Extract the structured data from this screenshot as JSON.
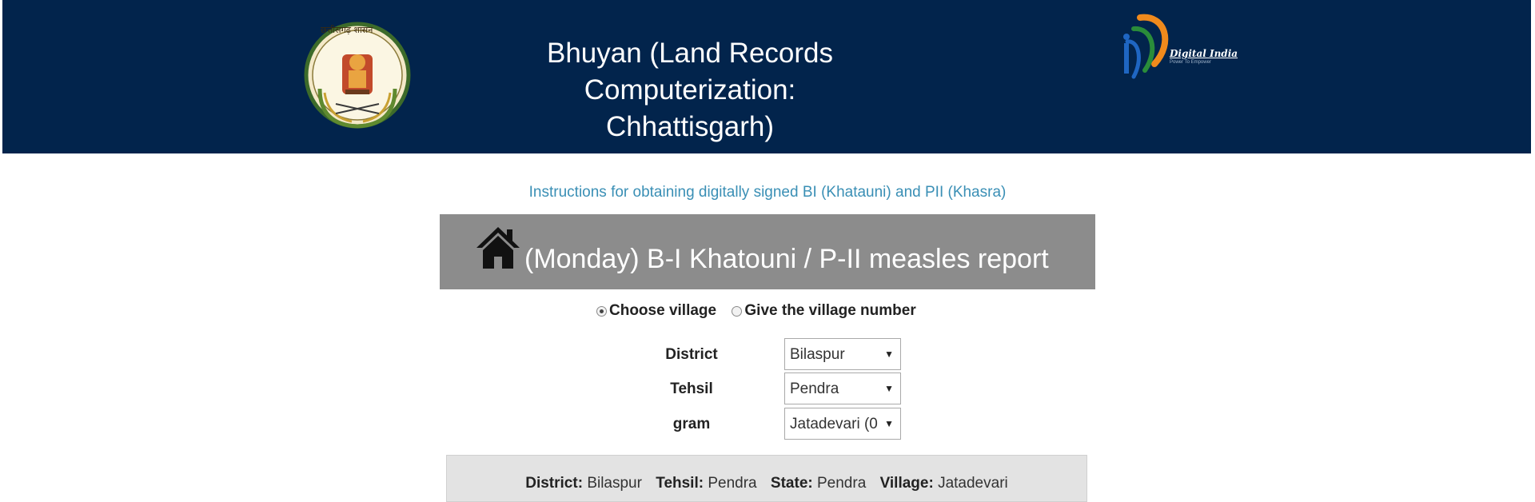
{
  "header": {
    "title_line1": "Bhuyan (Land Records Computerization:",
    "title_line2": "Chhattisgarh)",
    "seal_text": "छत्तीसगढ़ शासन",
    "digital_india_label": "Digital India",
    "digital_india_tagline": "Power To Empower",
    "background_color": "#02244c"
  },
  "instructions_link": "Instructions for obtaining digitally signed BI (Khatauni) and PII (Khasra)",
  "report": {
    "title": "(Monday) B-I Khatouni / P-II measles report",
    "home_icon": "home-icon"
  },
  "mode": {
    "option1": "Choose village",
    "option2": "Give the village number",
    "selected": "option1"
  },
  "form": {
    "district_label": "District",
    "district_value": "Bilaspur",
    "tehsil_label": "Tehsil",
    "tehsil_value": "Pendra",
    "gram_label": "gram",
    "gram_value": "Jatadevari (0"
  },
  "summary": {
    "district_label": "District:",
    "district_value": "Bilaspur",
    "tehsil_label": "Tehsil:",
    "tehsil_value": "Pendra",
    "state_label": "State:",
    "state_value": "Pendra",
    "village_label": "Village:",
    "village_value": "Jatadevari"
  }
}
